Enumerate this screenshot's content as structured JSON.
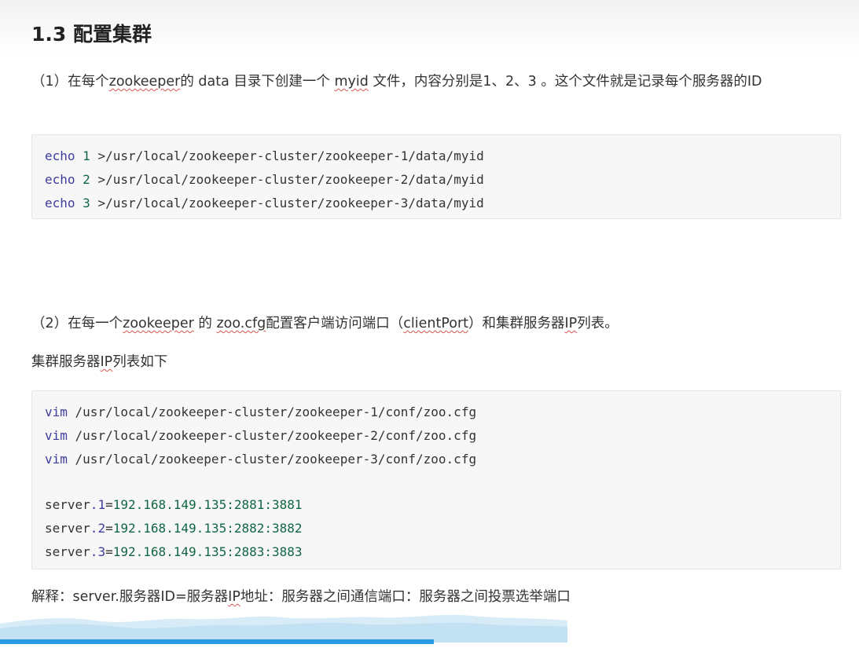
{
  "heading": "1.3 配置集群",
  "step1": {
    "prefix": "（1）在每个",
    "zookeeper": "zookeeper",
    "mid1": "的 data 目录下创建一个 ",
    "myid": "myid",
    "suffix": " 文件，内容分别是1、2、3 。这个文件就是记录每个服务器的ID"
  },
  "code1": {
    "lines": [
      {
        "cmd": "echo",
        "arg": "1",
        "path": " >/usr/local/zookeeper-cluster/zookeeper-1/data/myid"
      },
      {
        "cmd": "echo",
        "arg": "2",
        "path": " >/usr/local/zookeeper-cluster/zookeeper-2/data/myid"
      },
      {
        "cmd": "echo",
        "arg": "3",
        "path": " >/usr/local/zookeeper-cluster/zookeeper-3/data/myid"
      }
    ]
  },
  "step2": {
    "prefix": "（2）在每一个",
    "zookeeper": "zookeeper",
    "mid1": " 的 ",
    "zoocfg": "zoo.cfg",
    "mid2": "配置客户端访问端口（",
    "clientport": "clientPort",
    "mid3": "）和集群服务器",
    "ip": "IP",
    "suffix": "列表。"
  },
  "step3": {
    "prefix": "集群服务器",
    "ip": "IP",
    "suffix": "列表如下"
  },
  "code2": {
    "vim_lines": [
      {
        "cmd": "vim",
        "path": " /usr/local/zookeeper-cluster/zookeeper-1/conf/zoo.cfg"
      },
      {
        "cmd": "vim",
        "path": " /usr/local/zookeeper-cluster/zookeeper-2/conf/zoo.cfg"
      },
      {
        "cmd": "vim",
        "path": " /usr/local/zookeeper-cluster/zookeeper-3/conf/zoo.cfg"
      }
    ],
    "server_lines": [
      {
        "key": "server",
        "dot": ".",
        "id": "1",
        "eq": "=",
        "addr": "192.168.149.135:2881:3881"
      },
      {
        "key": "server",
        "dot": ".",
        "id": "2",
        "eq": "=",
        "addr": "192.168.149.135:2882:3882"
      },
      {
        "key": "server",
        "dot": ".",
        "id": "3",
        "eq": "=",
        "addr": "192.168.149.135:2883:3883"
      }
    ]
  },
  "explain": {
    "prefix": "解释：server.服务器ID=服务器",
    "ip": "IP",
    "suffix": "地址：服务器之间通信端口：服务器之间投票选举端口"
  },
  "video": {
    "progress": 0.505
  },
  "colors": {
    "keyword": "#3d3d9e",
    "number": "#116644",
    "progress": "#2a9be0",
    "squiggle": "#d9534f"
  }
}
